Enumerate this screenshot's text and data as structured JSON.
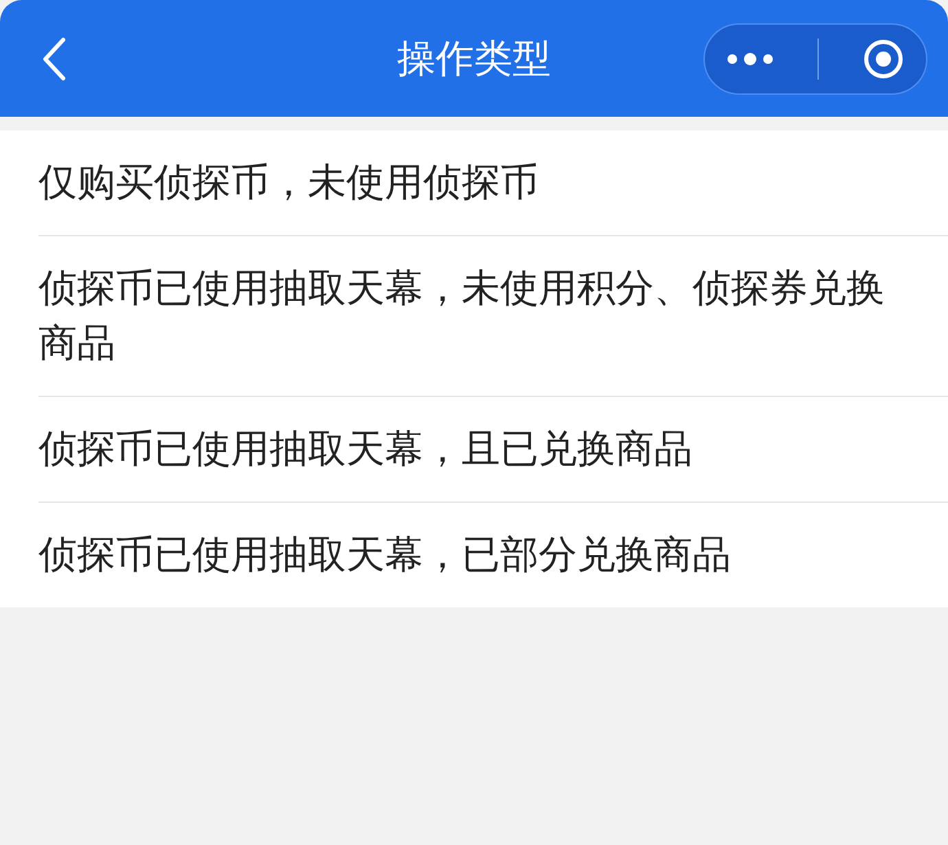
{
  "header": {
    "title": "操作类型"
  },
  "options": [
    {
      "label": "仅购买侦探币，未使用侦探币"
    },
    {
      "label": "侦探币已使用抽取天幕，未使用积分、侦探券兑换商品"
    },
    {
      "label": "侦探币已使用抽取天幕，且已兑换商品"
    },
    {
      "label": "侦探币已使用抽取天幕，已部分兑换商品"
    }
  ]
}
